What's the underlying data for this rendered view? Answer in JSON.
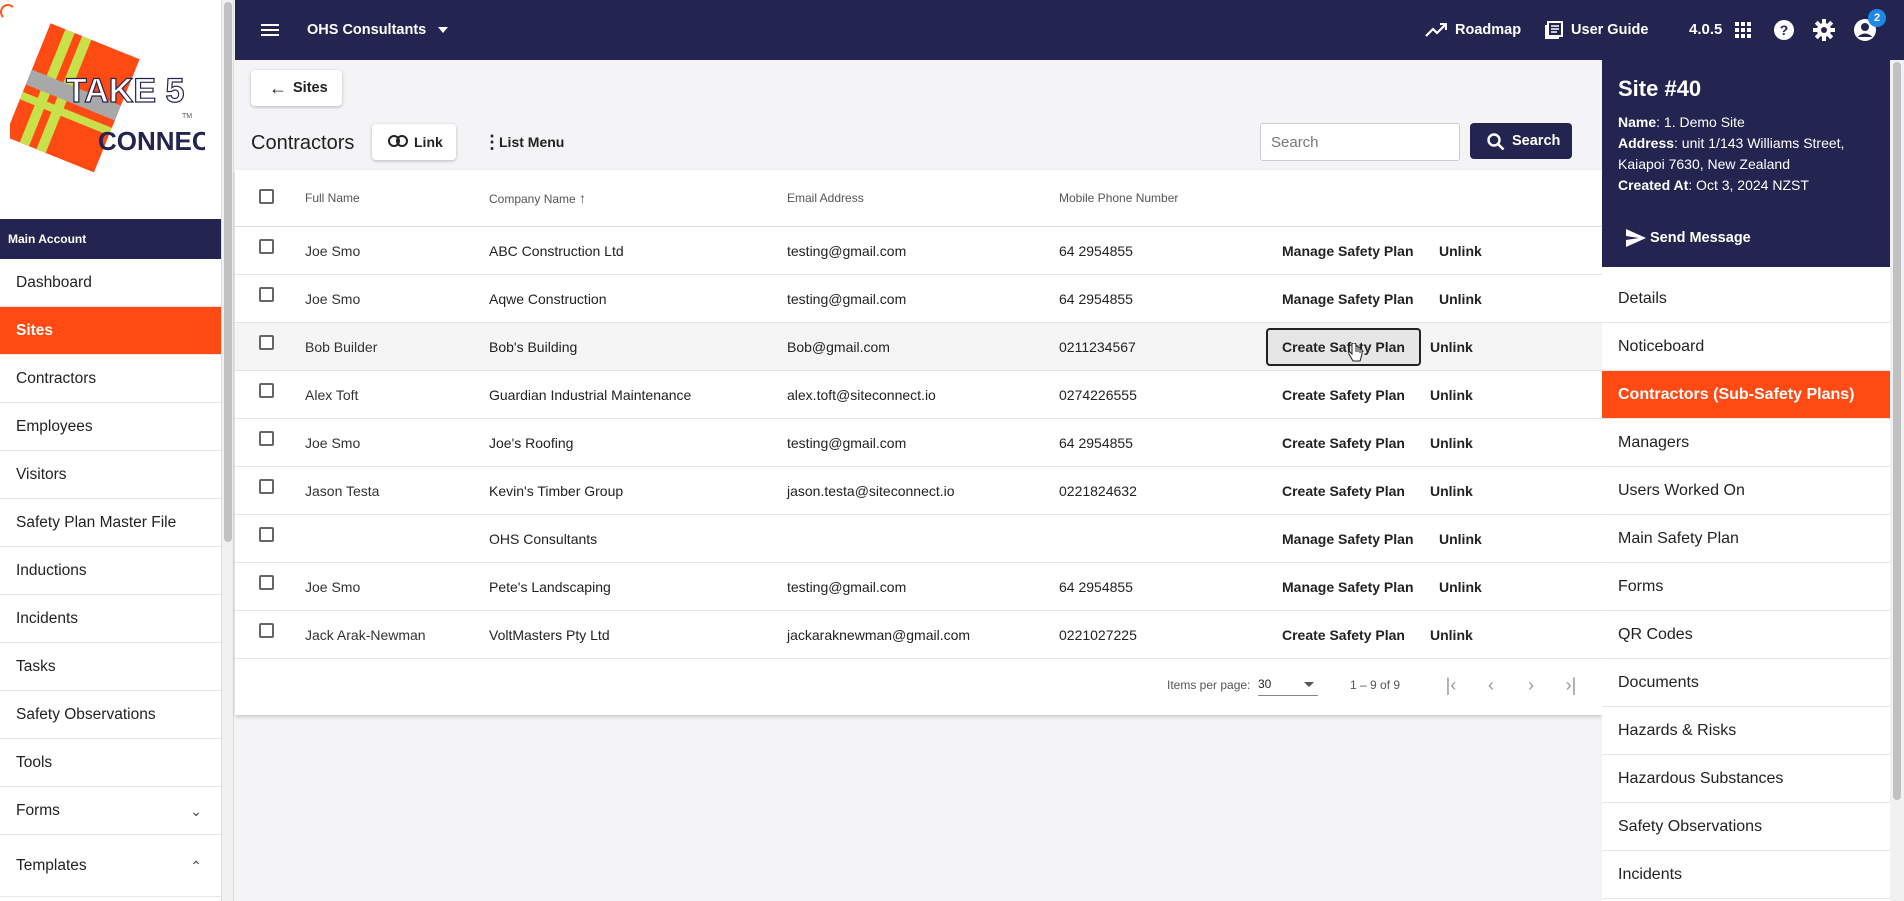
{
  "brand": {
    "logo_text_top": "TAKE 5",
    "logo_text_bottom": "CONNECT",
    "logo_tm": "TM",
    "colors": {
      "navy": "#232550",
      "accent": "#ff4a14"
    }
  },
  "topbar": {
    "account": "OHS Consultants",
    "roadmap": "Roadmap",
    "user_guide": "User Guide",
    "version": "4.0.5",
    "notification_count": "2"
  },
  "sidebar": {
    "section_label": "Main Account",
    "items": [
      {
        "label": "Dashboard"
      },
      {
        "label": "Sites"
      },
      {
        "label": "Contractors"
      },
      {
        "label": "Employees"
      },
      {
        "label": "Visitors"
      },
      {
        "label": "Safety Plan Master File"
      },
      {
        "label": "Inductions"
      },
      {
        "label": "Incidents"
      },
      {
        "label": "Tasks"
      },
      {
        "label": "Safety Observations"
      },
      {
        "label": "Tools"
      },
      {
        "label": "Forms"
      },
      {
        "label": "Templates"
      }
    ]
  },
  "main": {
    "back_label": "Sites",
    "title": "Contractors",
    "link_label": "Link",
    "list_menu_label": "List Menu",
    "search_placeholder": "Search",
    "search_button": "Search",
    "columns": {
      "full_name": "Full Name",
      "company_name": "Company Name",
      "email": "Email Address",
      "phone": "Mobile Phone Number"
    },
    "rows": [
      {
        "name": "Joe Smo",
        "company": "ABC Construction Ltd",
        "email": "testing@gmail.com",
        "phone": "64 2954855",
        "action": "Manage Safety Plan",
        "unlink": "Unlink"
      },
      {
        "name": "Joe Smo",
        "company": "Aqwe Construction",
        "email": "testing@gmail.com",
        "phone": "64 2954855",
        "action": "Manage Safety Plan",
        "unlink": "Unlink"
      },
      {
        "name": "Bob Builder",
        "company": "Bob's Building",
        "email": "Bob@gmail.com",
        "phone": "0211234567",
        "action": "Create Safety Plan",
        "unlink": "Unlink"
      },
      {
        "name": "Alex Toft",
        "company": "Guardian Industrial Maintenance",
        "email": "alex.toft@siteconnect.io",
        "phone": "0274226555",
        "action": "Create Safety Plan",
        "unlink": "Unlink"
      },
      {
        "name": "Joe Smo",
        "company": "Joe's Roofing",
        "email": "testing@gmail.com",
        "phone": "64 2954855",
        "action": "Create Safety Plan",
        "unlink": "Unlink"
      },
      {
        "name": "Jason Testa",
        "company": "Kevin's Timber Group",
        "email": "jason.testa@siteconnect.io",
        "phone": "0221824632",
        "action": "Create Safety Plan",
        "unlink": "Unlink"
      },
      {
        "name": "",
        "company": "OHS Consultants",
        "email": "",
        "phone": "",
        "action": "Manage Safety Plan",
        "unlink": "Unlink"
      },
      {
        "name": "Joe Smo",
        "company": "Pete's Landscaping",
        "email": "testing@gmail.com",
        "phone": "64 2954855",
        "action": "Manage Safety Plan",
        "unlink": "Unlink"
      },
      {
        "name": "Jack Arak-Newman",
        "company": "VoltMasters Pty Ltd",
        "email": "jackaraknewman@gmail.com",
        "phone": "0221027225",
        "action": "Create Safety Plan",
        "unlink": "Unlink"
      }
    ],
    "pager": {
      "items_per_page_label": "Items per page:",
      "items_per_page": "30",
      "range": "1 – 9 of 9"
    }
  },
  "site_panel": {
    "title": "Site #40",
    "name_label": "Name",
    "name_value": ": 1. Demo Site",
    "address_label": "Address",
    "address_value": ": unit 1/143 Williams Street, Kaiapoi 7630, New Zealand",
    "created_label": "Created At",
    "created_value": ": Oct 3, 2024 NZST",
    "send_message": "Send Message",
    "menu": [
      {
        "label": "Details"
      },
      {
        "label": "Noticeboard"
      },
      {
        "label": "Contractors (Sub-Safety Plans)"
      },
      {
        "label": "Managers"
      },
      {
        "label": "Users Worked On"
      },
      {
        "label": "Main Safety Plan"
      },
      {
        "label": "Forms"
      },
      {
        "label": "QR Codes"
      },
      {
        "label": "Documents"
      },
      {
        "label": "Hazards & Risks"
      },
      {
        "label": "Hazardous Substances"
      },
      {
        "label": "Safety Observations"
      },
      {
        "label": "Incidents"
      }
    ]
  }
}
